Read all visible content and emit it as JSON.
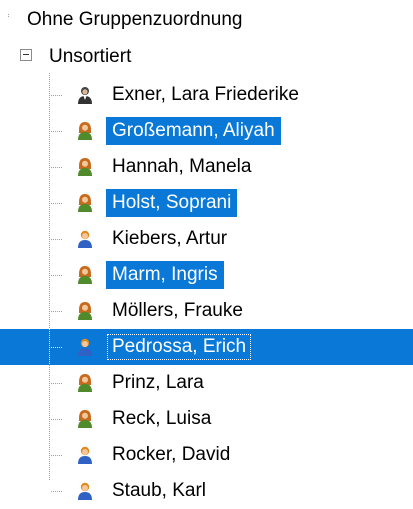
{
  "tree": {
    "root_label": "Ohne Gruppenzuordnung",
    "group": {
      "label": "Unsortiert",
      "expanded": true
    },
    "items": [
      {
        "name": "Exner, Lara Friederike",
        "icon": "person-dark-icon",
        "selected": false,
        "current": false
      },
      {
        "name": "Großemann, Aliyah",
        "icon": "person-female-icon",
        "selected": true,
        "current": false
      },
      {
        "name": "Hannah, Manela",
        "icon": "person-female-icon",
        "selected": false,
        "current": false
      },
      {
        "name": "Holst, Soprani",
        "icon": "person-female-icon",
        "selected": true,
        "current": false
      },
      {
        "name": "Kiebers, Artur",
        "icon": "person-male-icon",
        "selected": false,
        "current": false
      },
      {
        "name": "Marm, Ingris",
        "icon": "person-female-icon",
        "selected": true,
        "current": false
      },
      {
        "name": "Möllers, Frauke",
        "icon": "person-female-icon",
        "selected": false,
        "current": false
      },
      {
        "name": "Pedrossa, Erich",
        "icon": "person-male-icon",
        "selected": true,
        "current": true
      },
      {
        "name": "Prinz, Lara",
        "icon": "person-female-icon",
        "selected": false,
        "current": false
      },
      {
        "name": "Reck, Luisa",
        "icon": "person-female-icon",
        "selected": false,
        "current": false
      },
      {
        "name": "Rocker, David",
        "icon": "person-male-icon",
        "selected": false,
        "current": false
      },
      {
        "name": "Staub, Karl",
        "icon": "person-male-icon",
        "selected": false,
        "current": false
      }
    ]
  },
  "colors": {
    "selection": "#0a78d7",
    "female_body": "#4f8a2b",
    "female_hair": "#c86a1e",
    "male_body": "#2f62c4",
    "male_hair": "#e08a1e",
    "dark_body": "#333333"
  }
}
